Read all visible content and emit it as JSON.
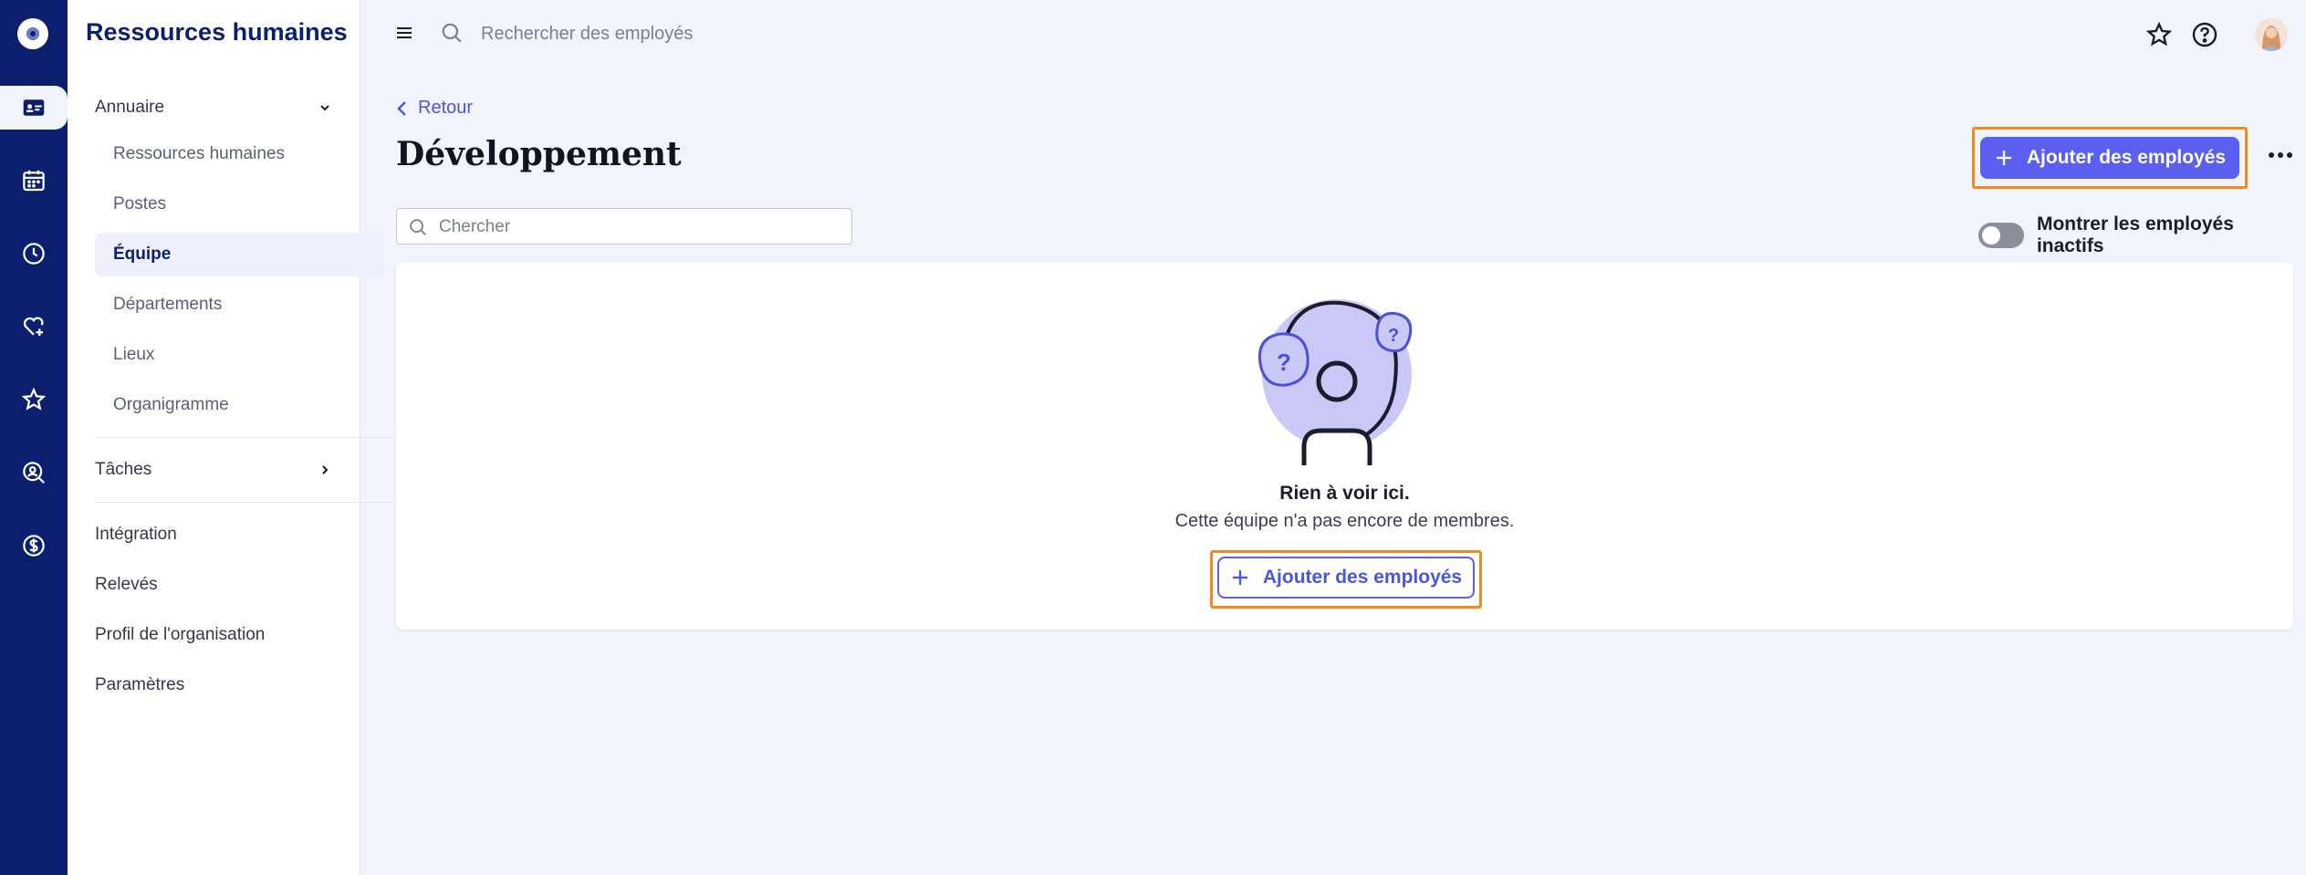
{
  "app": {
    "section_title": "Ressources humaines"
  },
  "rail": {
    "items": [
      {
        "icon": "logo-icon"
      },
      {
        "icon": "id-card-icon",
        "active": true
      },
      {
        "icon": "calendar-icon"
      },
      {
        "icon": "clock-icon"
      },
      {
        "icon": "heart-plus-icon"
      },
      {
        "icon": "star-icon"
      },
      {
        "icon": "search-person-icon"
      },
      {
        "icon": "dollar-icon"
      }
    ]
  },
  "sidebar": {
    "groups": [
      {
        "label": "Annuaire",
        "expanded": true,
        "icon": "chevron-down-icon"
      },
      {
        "label": "Tâches",
        "expanded": false,
        "icon": "chevron-right-icon"
      }
    ],
    "annuaire_items": [
      {
        "label": "Ressources humaines"
      },
      {
        "label": "Postes"
      },
      {
        "label": "Équipe",
        "active": true
      },
      {
        "label": "Départements"
      },
      {
        "label": "Lieux"
      },
      {
        "label": "Organigramme"
      }
    ],
    "bottom_items": [
      {
        "label": "Intégration"
      },
      {
        "label": "Relevés"
      },
      {
        "label": "Profil de l'organisation"
      },
      {
        "label": "Paramètres"
      }
    ]
  },
  "topbar": {
    "search_placeholder": "Rechercher des employés",
    "icons": [
      "menu-icon",
      "search-icon",
      "star-icon",
      "help-icon",
      "avatar"
    ]
  },
  "main": {
    "back_label": "Retour",
    "title": "Développement",
    "add_button_label": "Ajouter des employés",
    "filter_placeholder": "Chercher",
    "toggle_label": "Montrer les employés inactifs",
    "toggle_on": false,
    "empty_title": "Rien à voir ici.",
    "empty_subtitle": "Cette équipe n'a pas encore de membres.",
    "empty_button_label": "Ajouter des employés"
  },
  "colors": {
    "rail": "#0c1f6f",
    "accent": "#5a5ff0",
    "highlight": "#f28a1d",
    "background": "#f2f4fb"
  }
}
